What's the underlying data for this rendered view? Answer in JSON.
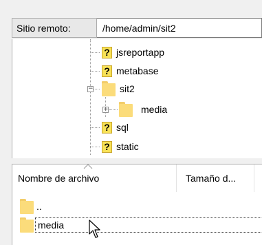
{
  "remote_path": {
    "label": "Sitio remoto:",
    "value": "/home/admin/sit2"
  },
  "tree": {
    "items": [
      {
        "name": "jsreportapp",
        "icon": "question-icon"
      },
      {
        "name": "metabase",
        "icon": "question-icon"
      },
      {
        "name": "sit2",
        "icon": "folder-icon",
        "expanded": true
      },
      {
        "name": "media",
        "icon": "folder-icon",
        "expanded": false
      },
      {
        "name": "sql",
        "icon": "question-icon"
      },
      {
        "name": "static",
        "icon": "question-icon"
      }
    ],
    "expander_collapse": "−",
    "expander_expand": "+"
  },
  "file_list": {
    "columns": [
      {
        "label": "Nombre de archivo"
      },
      {
        "label": "Tamaño d..."
      }
    ],
    "rows": [
      {
        "name": ".."
      },
      {
        "name": "media"
      }
    ]
  },
  "colors": {
    "folder": "#fbdc7b",
    "unknown_icon": "#f8e257",
    "background": "#f0f0f0"
  }
}
